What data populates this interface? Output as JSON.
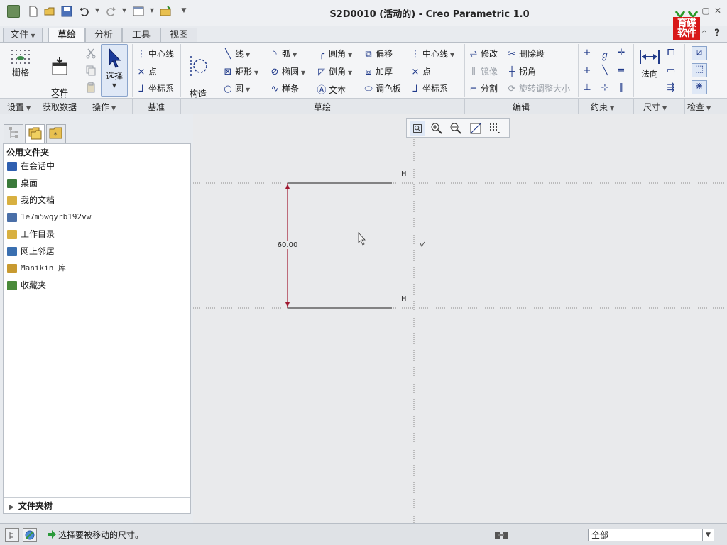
{
  "window": {
    "title": "S2D0010 (活动的) - Creo Parametric 1.0",
    "logo_text": "育碟软件"
  },
  "tabs": [
    {
      "label": "文件",
      "active": false
    },
    {
      "label": "草绘",
      "active": true
    },
    {
      "label": "分析",
      "active": false
    },
    {
      "label": "工具",
      "active": false
    },
    {
      "label": "视图",
      "active": false
    }
  ],
  "ribbon": {
    "big": {
      "grid": "栅格",
      "file_system": "文件\n系统",
      "select": "选择",
      "construct_mode": "构造\n模式",
      "normal": "法向"
    },
    "datum": {
      "centerline": "中心线",
      "point": "点",
      "coord": "坐标系"
    },
    "sketch": {
      "line": "线",
      "rect": "矩形",
      "circle": "圆",
      "arc": "弧",
      "ellipse": "椭圆",
      "spline": "样条",
      "fillet": "圆角",
      "chamfer": "倒角",
      "text": "文本",
      "offset": "偏移",
      "thicken": "加厚",
      "palette": "调色板",
      "centerline": "中心线",
      "point": "点",
      "coord": "坐标系"
    },
    "edit": {
      "modify": "修改",
      "delete_segment": "删除段",
      "mirror": "镜像",
      "corner": "拐角",
      "divide": "分割",
      "rotate_resize": "旋转调整大小"
    },
    "groups": {
      "setup": "设置",
      "get_data": "获取数据",
      "operations": "操作",
      "datum": "基准",
      "sketching": "草绘",
      "editing": "编辑",
      "constrain": "约束",
      "dimension": "尺寸",
      "inspect": "检查"
    }
  },
  "panel": {
    "title": "公用文件夹",
    "items": [
      {
        "label": "在会话中",
        "icon": "session-icon",
        "color": "#2f5fb0"
      },
      {
        "label": "桌面",
        "icon": "desktop-icon",
        "color": "#3a7a3a"
      },
      {
        "label": "我的文档",
        "icon": "documents-icon",
        "color": "#d8b040"
      },
      {
        "label": "1e7m5wqyrb192vw",
        "icon": "computer-icon",
        "color": "#4a6fa8"
      },
      {
        "label": "工作目录",
        "icon": "working-dir-icon",
        "color": "#d8b040"
      },
      {
        "label": "网上邻居",
        "icon": "network-icon",
        "color": "#3a6fb0"
      },
      {
        "label": "Manikin 库",
        "icon": "manikin-library-icon",
        "color": "#c89a30"
      },
      {
        "label": "收藏夹",
        "icon": "favorites-icon",
        "color": "#4a8a3a"
      }
    ],
    "folder_tree": "文件夹树"
  },
  "sketch": {
    "dimension": "60.00",
    "constraint_h": "H"
  },
  "status": {
    "message": "选择要被移动的尺寸。",
    "filter": "全部"
  },
  "colors": {
    "dimension": "#a01830",
    "entity": "#1a1a1a",
    "accent": "#203a8a"
  }
}
